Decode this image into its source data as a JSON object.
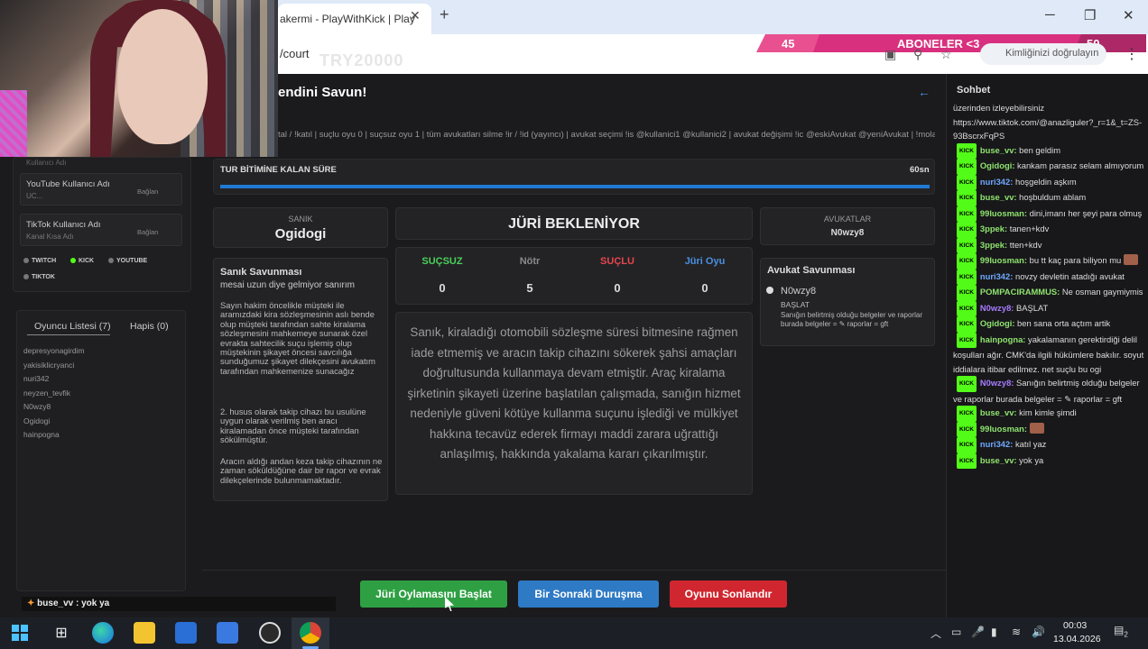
{
  "browser": {
    "tab_title": "akermi - PlayWithKick | Play",
    "tab_close": "✕",
    "new_tab": "+",
    "url": "/court",
    "url_overlay": "TRY20000",
    "profile_chip": "Kimliğinizi doğrulayın",
    "window_minimize": "─",
    "window_restore": "❐",
    "window_close": "✕"
  },
  "sub_goal": {
    "left": "45",
    "center": "ABONELER <3",
    "right": "50"
  },
  "page": {
    "title": "endini Savun!",
    "back": "←",
    "commands": "tal / !katıl | suçlu oyu 0 | suçsuz oyu 1 | tüm avukatları silme !ir / !id (yayıncı) | avukat seçimi !is @kullanici1 @kullanici2 | avukat değişimi !ic @eskiAvukat @yeniAvukat | !mola / ..."
  },
  "timer": {
    "label": "TUR BİTİMİNE KALAN SÜRE",
    "value": "60sn",
    "progress_percent": 100
  },
  "sanik": {
    "label": "SANIK",
    "name": "Ogidogi"
  },
  "jury": {
    "status": "JÜRİ BEKLENİYOR",
    "votes": [
      {
        "label": "SUÇSUZ",
        "value": "0",
        "color": "#4bd05a"
      },
      {
        "label": "Nötr",
        "value": "5",
        "color": "#8a8a8a"
      },
      {
        "label": "SUÇLU",
        "value": "0",
        "color": "#e8464e"
      },
      {
        "label": "Jüri Oyu",
        "value": "0",
        "color": "#4a90e2"
      }
    ]
  },
  "avukat": {
    "label": "AVUKATLAR",
    "name": "N0wzy8"
  },
  "defense": {
    "title": "Sanık Savunması",
    "subtitle": "mesai uzun diye gelmiyor sanırım",
    "p1": "Sayın hakim öncelikle müşteki ile aramızdaki kira sözleşmesinin aslı bende olup müşteki tarafından sahte kiralama sözleşmesini mahkemeye sunarak özel evrakta sahtecilik suçu işlemiş olup müştekinin şikayet öncesi savcılığa sunduğumuz şikayet dilekçesini avukatım tarafından mahkemenize sunacağız",
    "p2": "2. husus olarak takip cihazı bu usulüne uygun olarak verilmiş ben aracı kiralamadan önce müşteki tarafından sökülmüştür.",
    "p3": "Aracın aldığı andan keza takip cihazının ne zaman söküldüğüne dair bir rapor ve evrak dilekçelerinde bulunmamaktadır."
  },
  "case_text": "Sanık, kiraladığı otomobili sözleşme süresi bitmesine rağmen iade etmemiş ve aracın takip cihazını sökerek şahsi amaçları doğrultusunda kullanmaya devam etmiştir. Araç kiralama şirketinin şikayeti üzerine başlatılan çalışmada, sanığın hizmet nedeniyle güveni kötüye kullanma suçunu işlediği ve mülkiyet hakkına tecavüz ederek firmayı maddi zarara uğrattığı anlaşılmış, hakkında yakalama kararı çıkarılmıştır.",
  "lawyer_defense": {
    "title": "Avukat Savunması",
    "name": "N0wzy8",
    "msg1": "BAŞLAT",
    "msg2": "Sanığın belirtmiş olduğu belgeler ve raporlar burada belgeler = ✎ raporlar = gft"
  },
  "accounts": {
    "partial_label": "Kullanıcı Adı",
    "youtube_title": "YouTube Kullanıcı Adı",
    "youtube_sub": "UC...",
    "tiktok_title": "TikTok Kullanıcı Adı",
    "tiktok_sub": "Kanal Kısa Adı",
    "connect": "Bağlan",
    "platforms": [
      {
        "label": "TWITCH",
        "color": "#777"
      },
      {
        "label": "KICK",
        "color": "#53fc18"
      },
      {
        "label": "YOUTUBE",
        "color": "#777"
      },
      {
        "label": "TIKTOK",
        "color": "#777"
      }
    ]
  },
  "players": {
    "tab_list": "Oyuncu Listesi (7)",
    "tab_jail": "Hapis (0)",
    "items": [
      "depresyonagirdim",
      "yakisiklicryanci",
      "nuri342",
      "neyzen_tevfik",
      "N0wzy8",
      "Ogidogi",
      "hainpogna"
    ]
  },
  "ticker": {
    "user": "buse_vv",
    "text": " : yok ya"
  },
  "buttons": {
    "start_vote": "Jüri Oylamasını Başlat",
    "next_hearing": "Bir Sonraki Duruşma",
    "end_game": "Oyunu Sonlandır"
  },
  "chat": {
    "title": "Sohbet",
    "badge": "KICK",
    "top_text": [
      "üzerinden izleyebilirsiniz",
      "https://www.tiktok.com/@anazliguler?_r=1&_t=ZS-93BscrxFqPS"
    ],
    "messages": [
      {
        "user": "buse_vv",
        "color": "green",
        "text": "ben geldim"
      },
      {
        "user": "Ogidogi",
        "color": "green",
        "text": "kankam parasız selam almıyorum"
      },
      {
        "user": "nuri342",
        "color": "blue",
        "text": "hoşgeldin aşkım"
      },
      {
        "user": "buse_vv",
        "color": "green",
        "text": "hoşbuldum ablam"
      },
      {
        "user": "99luosman",
        "color": "green",
        "text": "dini,imanı her şeyi para olmuş"
      },
      {
        "user": "3ppek",
        "color": "green",
        "text": "tanen+kdv"
      },
      {
        "user": "3ppek",
        "color": "green",
        "text": "tten+kdv"
      },
      {
        "user": "99luosman",
        "color": "green",
        "text": "bu tt kaç para biliyon mu",
        "emote": true
      },
      {
        "user": "nuri342",
        "color": "blue",
        "text": "novzy devletin atadığı avukat"
      },
      {
        "user": "POMPACIRAMMUS",
        "color": "green",
        "text": "Ne osman gaymiymis"
      },
      {
        "user": "N0wzy8",
        "color": "purple",
        "text": "BAŞLAT"
      },
      {
        "user": "Ogidogi",
        "color": "green",
        "text": "ben sana orta açtım artik"
      },
      {
        "user": "hainpogna",
        "color": "green",
        "text": "yakalamanın gerektirdiği delil koşulları ağır. CMK'da ilgili hükümlere bakılır. soyut iddialara itibar edilmez. net suçlu bu ogi"
      },
      {
        "user": "N0wzy8",
        "color": "purple",
        "text": "Sanığın belirtmiş olduğu belgeler ve raporlar burada belgeler = ✎ raporlar = gft"
      },
      {
        "user": "buse_vv",
        "color": "green",
        "text": "kim kimle şimdi"
      },
      {
        "user": "99luosman",
        "color": "green",
        "text": "",
        "emote": true
      },
      {
        "user": "nuri342",
        "color": "blue",
        "text": "katıl yaz"
      },
      {
        "user": "buse_vv",
        "color": "green",
        "text": "yok ya"
      }
    ]
  },
  "taskbar": {
    "time": "00:03",
    "date": "13.04.2026",
    "notification_count": "2"
  },
  "colors": {
    "accent_blue": "#1f7ad4",
    "kick_green": "#53fc18",
    "sub_pink": "#d8307e",
    "start_green": "#2ea043",
    "end_red": "#d0262f"
  }
}
